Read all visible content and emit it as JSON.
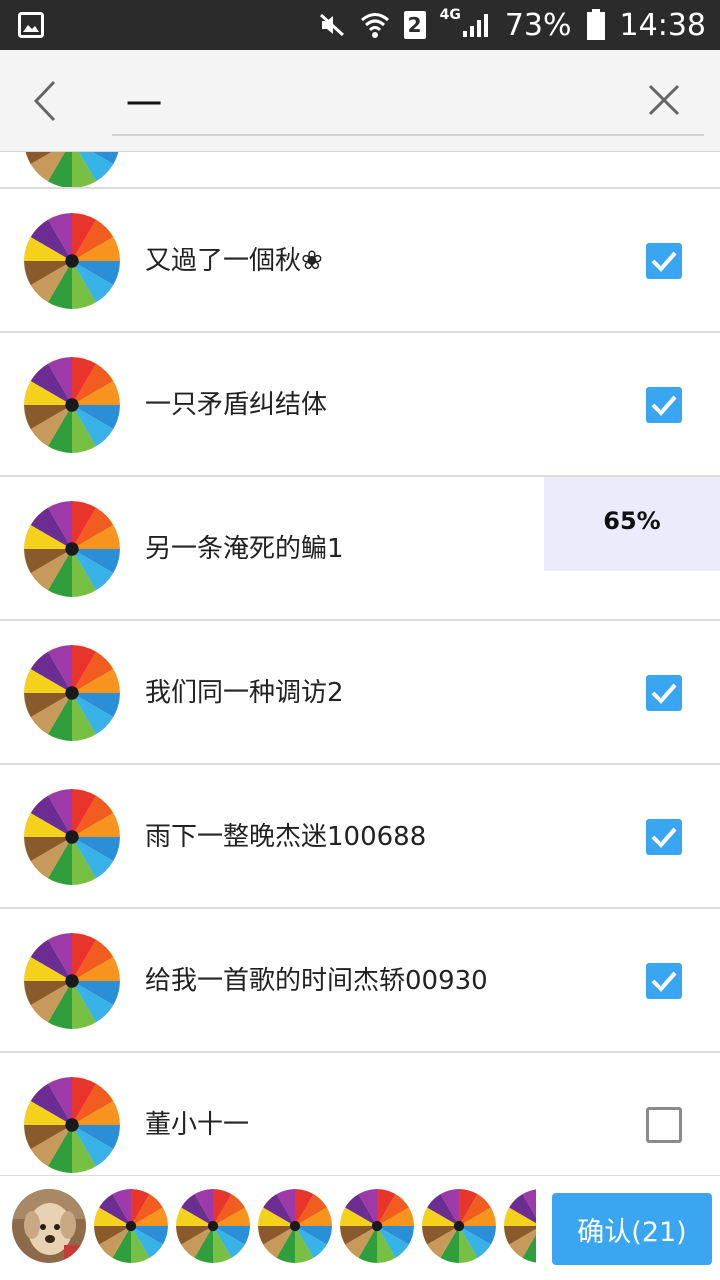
{
  "status_bar": {
    "battery": "73%",
    "time": "14:38",
    "network": "4G",
    "sim": "2",
    "icons": [
      "image-icon",
      "mute-icon",
      "wifi-icon",
      "sim-icon",
      "signal-icon",
      "battery-icon"
    ]
  },
  "search": {
    "value": "一",
    "back_icon": "chevron-left-icon",
    "clear_icon": "close-icon"
  },
  "contacts": [
    {
      "name": "又過了一個秋❀",
      "checked": true
    },
    {
      "name": "一只矛盾纠结体",
      "checked": true
    },
    {
      "name": "另一条淹死的鳊1",
      "checked": true
    },
    {
      "name": "我们同一种调访2",
      "checked": true
    },
    {
      "name": "雨下一整晚杰迷100688",
      "checked": true
    },
    {
      "name": "给我一首歌的时间杰轿00930",
      "checked": true
    },
    {
      "name": "董小十一",
      "checked": false
    }
  ],
  "overlay": {
    "progress_text": "65%",
    "progress_percent": 65
  },
  "bottom": {
    "confirm_label": "确认(21)"
  },
  "colors": {
    "accent": "#3aa6f2",
    "status_bar_bg": "#2b2b2b",
    "header_bg": "#f4f4f4",
    "divider": "#dcdcdc",
    "text": "#222222"
  }
}
